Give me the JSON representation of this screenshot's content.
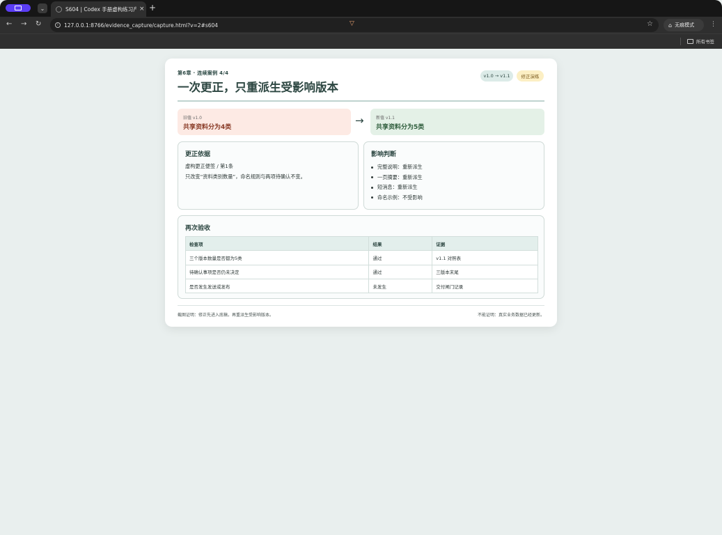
{
  "browser": {
    "tab_title": "S604 | Codex 手册虚构练习产",
    "tab_close": "×",
    "new_tab": "+",
    "tab_menu": "⌄",
    "back": "←",
    "forward": "→",
    "reload": "↻",
    "url": "127.0.0.1:8766/evidence_capture/capture.html?v=2#s604",
    "star": "☆",
    "incognito_label": "无痕模式",
    "menu": "⋮",
    "bookmarks_folder": "所有书签"
  },
  "page": {
    "eyebrow": "第6章 · 连续案例 4/4",
    "title": "一次更正，只重派生受影响版本",
    "badge_version": "v1.0 → v1.1",
    "badge_fix": "修正演练",
    "old": {
      "caption": "旧值 v1.0",
      "value": "共享资料分为4类"
    },
    "arrow": "→",
    "new": {
      "caption": "新值 v1.1",
      "value": "共享资料分为5类"
    },
    "basis": {
      "heading": "更正依据",
      "line1": "虚构更正便签 / 第1条",
      "line2": "只改变“资料类别数量”，命名规则与两项待确认不变。"
    },
    "impact": {
      "heading": "影响判断",
      "items": [
        "完整说明：重新派生",
        "一页摘要：重新派生",
        "短消息：重新派生",
        "命名示例：不受影响"
      ]
    },
    "recheck": {
      "heading": "再次验收",
      "columns": [
        "检查项",
        "结果",
        "证据"
      ],
      "rows": [
        [
          "三个版本数量是否都为5类",
          "通过",
          "v1.1 对照表"
        ],
        [
          "待确认事项是否仍未决定",
          "通过",
          "三版本末尾"
        ],
        [
          "是否发生发送或发布",
          "未发生",
          "交付闸门记录"
        ]
      ]
    },
    "footer_left": "截图证明：修正先进入底稿，再重派生受影响版本。",
    "footer_right": "不能证明：真实业务数据已经更新。"
  }
}
